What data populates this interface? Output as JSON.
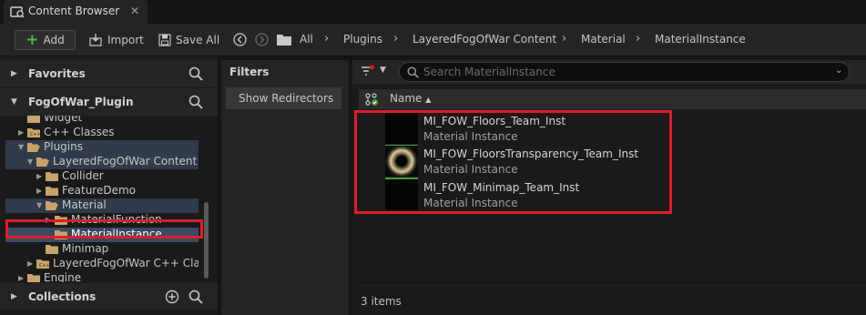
{
  "tab": {
    "title": "Content Browser",
    "close": "✕"
  },
  "toolbar": {
    "add": "Add",
    "import": "Import",
    "save_all": "Save All"
  },
  "breadcrumb": [
    "All",
    "Plugins",
    "LayeredFogOfWar Content",
    "Material",
    "MaterialInstance"
  ],
  "sidebar": {
    "favorites": "Favorites",
    "root": "FogOfWar_Plugin",
    "collections": "Collections",
    "tree": [
      {
        "label": "Widget",
        "indent": 1,
        "arrow": "",
        "icon": "folder"
      },
      {
        "label": "C++ Classes",
        "indent": 1,
        "arrow": "▶",
        "icon": "cpp-folder"
      },
      {
        "label": "Plugins",
        "indent": 1,
        "arrow": "▼",
        "icon": "folder-open"
      },
      {
        "label": "LayeredFogOfWar Content",
        "indent": 2,
        "arrow": "▼",
        "icon": "folder-open"
      },
      {
        "label": "Collider",
        "indent": 3,
        "arrow": "▶",
        "icon": "folder"
      },
      {
        "label": "FeatureDemo",
        "indent": 3,
        "arrow": "▶",
        "icon": "folder"
      },
      {
        "label": "Material",
        "indent": 3,
        "arrow": "▼",
        "icon": "folder-open"
      },
      {
        "label": "MaterialFunction",
        "indent": 4,
        "arrow": "▶",
        "icon": "folder"
      },
      {
        "label": "MaterialInstance",
        "indent": 4,
        "arrow": "",
        "icon": "folder"
      },
      {
        "label": "Minimap",
        "indent": 3,
        "arrow": "",
        "icon": "folder"
      },
      {
        "label": "LayeredFogOfWar C++ Classes",
        "indent": 2,
        "arrow": "▶",
        "icon": "cpp-folder"
      },
      {
        "label": "Engine",
        "indent": 1,
        "arrow": "▶",
        "icon": "folder"
      }
    ]
  },
  "filters": {
    "title": "Filters",
    "show_redirectors": "Show Redirectors"
  },
  "search": {
    "placeholder": "Search MaterialInstance"
  },
  "columns": {
    "name": "Name"
  },
  "assets": [
    {
      "name": "MI_FOW_Floors_Team_Inst",
      "type": "Material Instance"
    },
    {
      "name": "MI_FOW_FloorsTransparency_Team_Inst",
      "type": "Material Instance"
    },
    {
      "name": "MI_FOW_Minimap_Team_Inst",
      "type": "Material Instance"
    }
  ],
  "status": {
    "count": "3 items"
  },
  "colors": {
    "highlight": "#e21b2a",
    "folder": "#c9a468",
    "add_plus": "#59b255",
    "selected_row": "#2f3a4a"
  }
}
